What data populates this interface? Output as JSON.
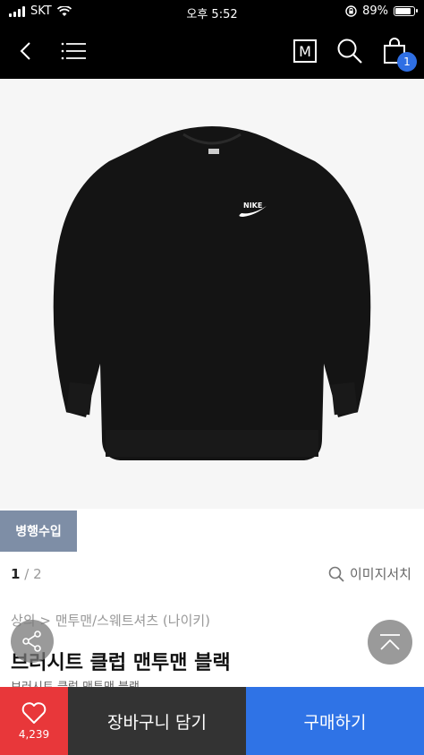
{
  "status_bar": {
    "carrier": "SKT",
    "time": "오후 5:52",
    "battery": "89%",
    "battery_level": 0.89
  },
  "header": {
    "m_label": "M",
    "cart_count": "1"
  },
  "product": {
    "tag": "병행수입",
    "pager_current": "1",
    "pager_sep": "/",
    "pager_total": "2",
    "image_search_label": "이미지서치",
    "breadcrumb": "상의 > 맨투맨/스웨트셔츠 (나이키)",
    "title": "브러시트 클럽 맨투맨 블랙",
    "subtitle": "브러시트 클럽 맨투맨 블랙",
    "logo_text": "NIKE"
  },
  "bottom_bar": {
    "like_count": "4,239",
    "cart_label": "장바구니 담기",
    "buy_label": "구매하기"
  },
  "colors": {
    "buy": "#2f73e6",
    "like": "#e8373a",
    "tag": "#7e8ea6"
  }
}
